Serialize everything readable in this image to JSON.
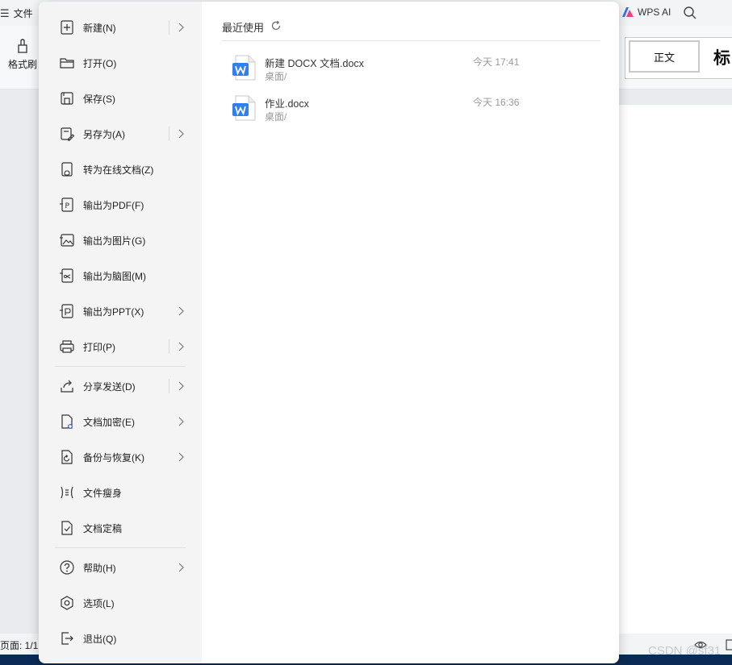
{
  "app": {
    "menu_label": "文件",
    "wps_ai_label": "WPS AI",
    "format_brush_label": "格式刷",
    "style_normal_label": "正文",
    "style_heading_label": "标",
    "status_page": "页面: 1/1",
    "watermark": "CSDN @sf31"
  },
  "menu": {
    "items": [
      {
        "label": "新建(N)",
        "icon": "new-icon"
      },
      {
        "label": "打开(O)",
        "icon": "folder-icon"
      },
      {
        "label": "保存(S)",
        "icon": "save-icon"
      },
      {
        "label": "另存为(A)",
        "icon": "save-as-icon"
      },
      {
        "label": "转为在线文档(Z)",
        "icon": "online-doc-icon"
      },
      {
        "label": "输出为PDF(F)",
        "icon": "pdf-icon"
      },
      {
        "label": "输出为图片(G)",
        "icon": "image-icon"
      },
      {
        "label": "输出为脑图(M)",
        "icon": "mindmap-icon"
      },
      {
        "label": "输出为PPT(X)",
        "icon": "ppt-icon"
      },
      {
        "label": "打印(P)",
        "icon": "print-icon"
      },
      {
        "label": "分享发送(D)",
        "icon": "share-icon"
      },
      {
        "label": "文档加密(E)",
        "icon": "encrypt-icon"
      },
      {
        "label": "备份与恢复(K)",
        "icon": "backup-icon"
      },
      {
        "label": "文件瘦身",
        "icon": "slim-icon"
      },
      {
        "label": "文档定稿",
        "icon": "finalize-icon"
      },
      {
        "label": "帮助(H)",
        "icon": "help-icon"
      },
      {
        "label": "选项(L)",
        "icon": "options-icon"
      },
      {
        "label": "退出(Q)",
        "icon": "exit-icon"
      }
    ]
  },
  "recent": {
    "title": "最近使用",
    "files": [
      {
        "name": "新建 DOCX 文档.docx",
        "path": "桌面/",
        "time": "今天 17:41"
      },
      {
        "name": "作业.docx",
        "path": "桌面/",
        "time": "今天 16:36"
      }
    ]
  },
  "colors": {
    "accent": "#2b7de9",
    "doc_icon": "#2f7ff0"
  }
}
